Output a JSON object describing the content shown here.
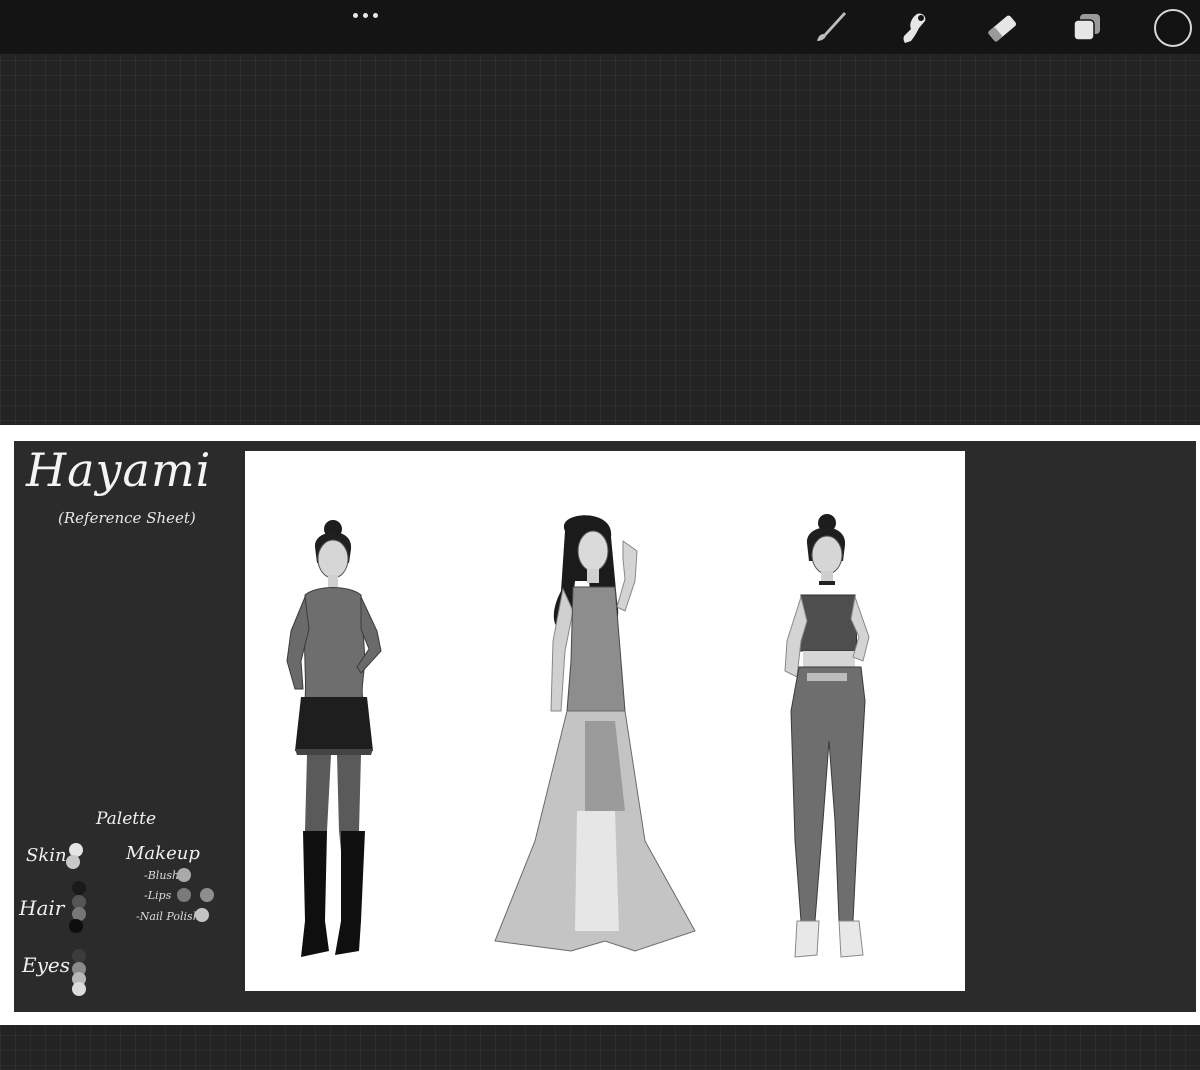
{
  "toolbar": {
    "more_icon": "ellipsis-icon",
    "tools": [
      {
        "name": "brush",
        "icon": "brush-icon"
      },
      {
        "name": "smudge",
        "icon": "smudge-icon"
      },
      {
        "name": "eraser",
        "icon": "eraser-icon"
      },
      {
        "name": "layers",
        "icon": "layers-icon"
      }
    ],
    "current_color": "#121212"
  },
  "sheet": {
    "title": "Hayami",
    "subtitle": "(Reference Sheet)",
    "palette": {
      "title": "Palette",
      "skin_label": "Skin",
      "hair_label": "Hair",
      "eyes_label": "Eyes",
      "makeup_label": "Makeup",
      "blush_label": "-Blush",
      "lips_label": "-Lips",
      "nail_label": "-Nail Polish",
      "skin_colors": [
        "#e4e4e4",
        "#c8c8c8"
      ],
      "hair_colors": [
        "#1a1a1a",
        "#555555",
        "#777777",
        "#0e0e0e"
      ],
      "eye_colors": [
        "#3c3c3c",
        "#8a8a8a",
        "#b8b8b8",
        "#dcdcdc"
      ],
      "blush_colors": [
        "#aaaaaa"
      ],
      "lips_colors": [
        "#7a7a7a",
        "#8e8e8e"
      ],
      "nail_colors": [
        "#c4c4c4"
      ]
    },
    "figures": [
      {
        "outfit": "blouse-and-skirt"
      },
      {
        "outfit": "sheer-gown"
      },
      {
        "outfit": "crop-top-and-trousers"
      }
    ]
  }
}
